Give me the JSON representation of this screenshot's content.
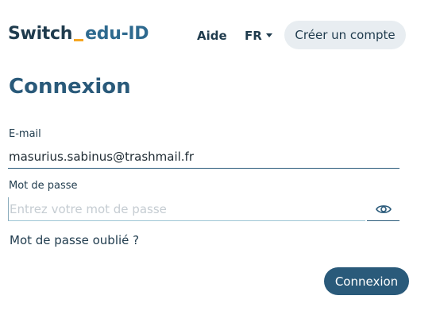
{
  "header": {
    "logo": {
      "brand": "Switch",
      "product": "edu-ID"
    },
    "help_label": "Aide",
    "language": "FR",
    "create_account_label": "Créer un compte"
  },
  "main": {
    "title": "Connexion",
    "email": {
      "label": "E-mail",
      "value": "masurius.sabinus@trashmail.fr"
    },
    "password": {
      "label": "Mot de passe",
      "placeholder": "Entrez votre mot de passe",
      "value": ""
    },
    "forgot_password_label": "Mot de passe oublié ?",
    "submit_label": "Connexion"
  },
  "colors": {
    "primary": "#2a5a7a",
    "accent": "#f5a623",
    "secondary_button_bg": "#e8edf1"
  }
}
